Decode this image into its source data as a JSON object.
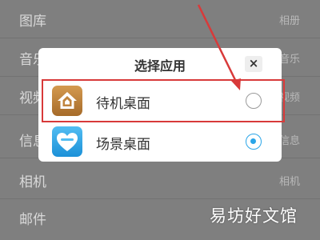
{
  "background_rows": [
    {
      "label": "图库",
      "value": "相册"
    },
    {
      "label": "音乐",
      "value": "音乐"
    },
    {
      "label": "视频",
      "value": "视频"
    },
    {
      "label": "信息",
      "value": "信息"
    },
    {
      "label": "相机",
      "value": "相机"
    },
    {
      "label": "邮件",
      "value": ""
    }
  ],
  "dialog": {
    "title": "选择应用",
    "close": "×",
    "options": [
      {
        "label": "待机桌面",
        "icon": "house-icon",
        "selected": false
      },
      {
        "label": "场景桌面",
        "icon": "heart-icon",
        "selected": true
      }
    ]
  },
  "annotation": {
    "highlight_color": "#d83a3a",
    "arrow_color": "#d83a3a"
  },
  "accent_color": "#2aa5e8",
  "watermark": "易坊好文馆"
}
